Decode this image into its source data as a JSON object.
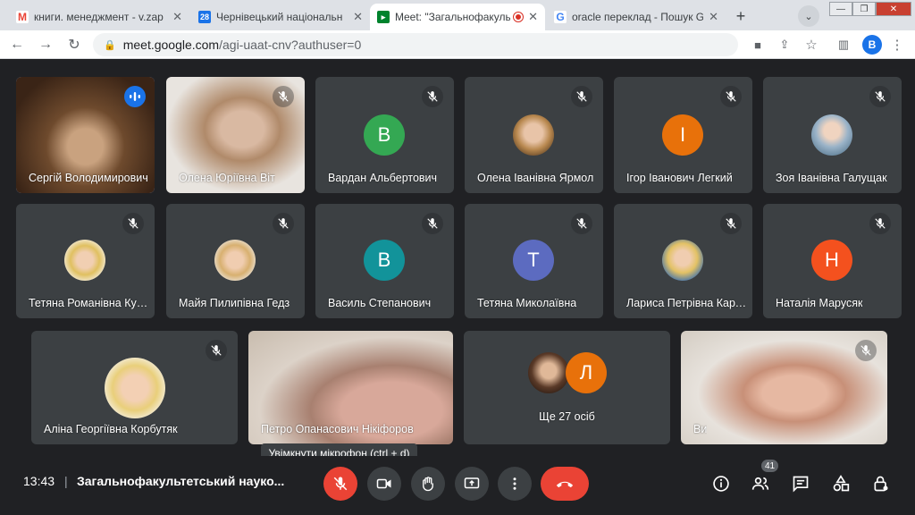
{
  "browser": {
    "tabs": [
      {
        "label": "книги. менеджмент - v.zap",
        "favicon": "gmail-icon"
      },
      {
        "label": "Чернівецький національн",
        "favicon": "calendar-icon",
        "badge": "28"
      },
      {
        "label": "Meet: \"Загальнофакульт",
        "favicon": "meet-icon"
      },
      {
        "label": "oracle переклад - Пошук G",
        "favicon": "google-icon"
      }
    ],
    "url_host": "meet.google.com",
    "url_path": "/agi-uaat-cnv?authuser=0",
    "profile_initial": "B"
  },
  "tiles": [
    {
      "name": "Сергій Володимирович",
      "kind": "video",
      "speaking": true
    },
    {
      "name": "Олена Юріївна Віт",
      "kind": "video"
    },
    {
      "name": "Вардан Альбертович",
      "kind": "initial",
      "initial": "В",
      "color": "#34a853"
    },
    {
      "name": "Олена Іванівна Ярмол",
      "kind": "photo"
    },
    {
      "name": "Ігор Іванович Легкий",
      "kind": "initial",
      "initial": "І",
      "color": "#e8710a"
    },
    {
      "name": "Зоя Іванівна Галущак",
      "kind": "photo"
    },
    {
      "name": "Тетяна Романівна Кушнір",
      "kind": "photo"
    },
    {
      "name": "Майя Пилипівна Гедз",
      "kind": "photo"
    },
    {
      "name": "Василь Степанович",
      "kind": "initial",
      "initial": "В",
      "color": "#12939a"
    },
    {
      "name": "Тетяна Миколаївна",
      "kind": "initial",
      "initial": "Т",
      "color": "#5c6bc0"
    },
    {
      "name": "Лариса Петрівна Кардаш",
      "kind": "photo"
    },
    {
      "name": "Наталія Марусяк",
      "kind": "initial",
      "initial": "Н",
      "color": "#f4511e"
    },
    {
      "name": "Аліна Георгіївна Корбутяк",
      "kind": "photo"
    },
    {
      "name": "Петро Опанасович Нікіфоров",
      "kind": "video"
    },
    {
      "name": "Ще 27 осіб",
      "kind": "more",
      "initial": "Л",
      "color": "#e8710a"
    },
    {
      "name": "Ви",
      "kind": "video"
    }
  ],
  "controls": {
    "time": "13:43",
    "separator": "|",
    "meeting_title": "Загальнофакультетський науко...",
    "tooltip": "Увімкнути мікрофон (ctrl + d)",
    "participants_count": "41"
  }
}
